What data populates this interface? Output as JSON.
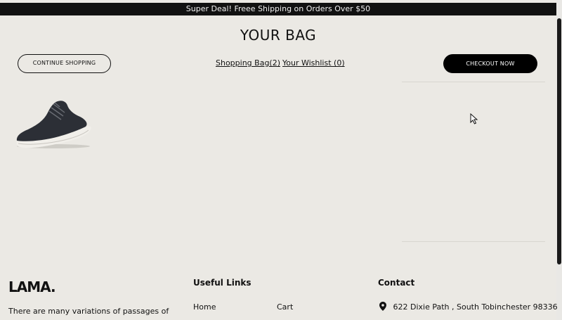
{
  "announcement": "Super Deal! Freee Shipping on Orders Over $50",
  "cart": {
    "title": "YOUR BAG",
    "continue_label": "CONTINUE SHOPPING",
    "bag_link": "Shopping Bag(2)",
    "wishlist_link": "Your Wishlist (0)",
    "checkout_label": "CHECKOUT NOW",
    "product_icon": "sneaker-image"
  },
  "footer": {
    "logo": "LAMA.",
    "description": "There are many variations of passages of",
    "links_title": "Useful Links",
    "links": [
      "Home",
      "Cart"
    ],
    "contact_title": "Contact",
    "address": "622 Dixie Path , South Tobinchester 98336"
  },
  "colors": {
    "background": "#ebe9e4",
    "announcement_bg": "#111111",
    "checkout_bg": "#000000"
  }
}
